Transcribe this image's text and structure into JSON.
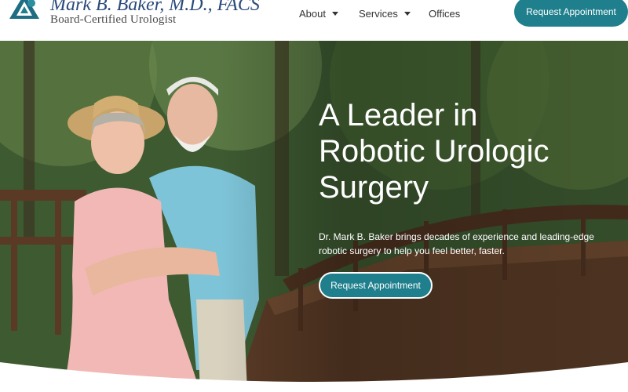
{
  "brand": {
    "name": "Mark B. Baker, M.D., FACS",
    "subtitle": "Board-Certified Urologist",
    "logo_icon": "triangle-swirl-logo-icon"
  },
  "nav": {
    "items": [
      {
        "label": "About",
        "has_dropdown": true
      },
      {
        "label": "Services",
        "has_dropdown": true
      },
      {
        "label": "Offices",
        "has_dropdown": false
      }
    ],
    "cta_label": "Request Appointment"
  },
  "hero": {
    "title_lines": [
      "A Leader in",
      "Robotic Urologic",
      "Surgery"
    ],
    "description": "Dr. Mark B. Baker brings decades of experience and leading-edge robotic surgery to help you feel better, faster.",
    "cta_label": "Request Appointment",
    "image": "photo-smiling-elderly-couple-on-wooden-bridge-in-forest"
  },
  "colors": {
    "accent": "#1f7f8c",
    "brand_text": "#2a4a7a",
    "nav_text": "#333333",
    "white": "#ffffff"
  }
}
